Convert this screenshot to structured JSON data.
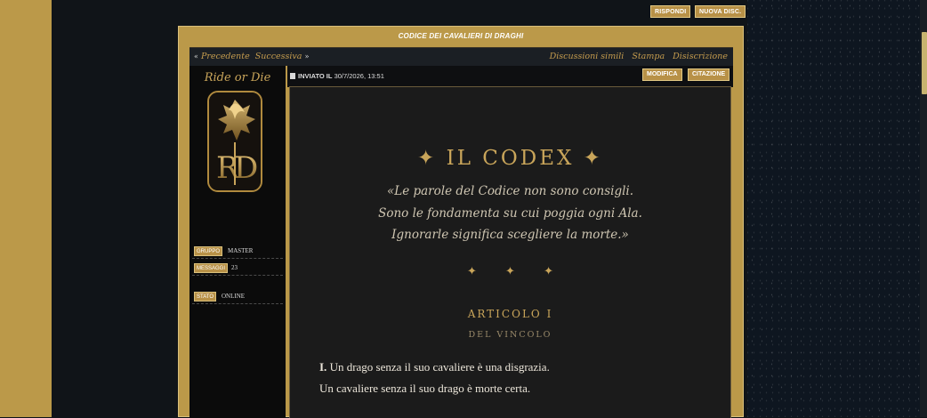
{
  "top_buttons": {
    "reply": "RISPONDI",
    "new_topic": "NUOVA DISC."
  },
  "topic": {
    "title": "CODICE DEI CAVALIERI DI DRAGHI"
  },
  "nav": {
    "prev_quote": "«",
    "prev": "Precedente",
    "next": "Successiva",
    "next_quote": "»",
    "similar": "Discussioni simili",
    "print": "Stampa",
    "unsubscribe": "Disiscrizione"
  },
  "profile": {
    "name": "Ride or Die",
    "group_label": "GRUPPO",
    "group_value": "MASTER",
    "messages_label": "MESSAGGI",
    "messages_value": "23",
    "status_label": "STATO",
    "status_value": "ONLINE"
  },
  "post": {
    "sent_label": "INVIATO IL",
    "date": "30/7/2026, 13:51",
    "edit_button": "MODIFICA",
    "quote_button": "CITAZIONE"
  },
  "content": {
    "title": "✦ IL CODEX ✦",
    "quote_lines": [
      "«Le parole del Codice non sono consigli.",
      "Sono le fondamenta su cui poggia ogni Ala.",
      "Ignorarle significa scegliere la morte.»"
    ],
    "stars": "✦ ✦ ✦",
    "article_title": "ARTICOLO I",
    "article_subtitle": "DEL VINCOLO",
    "article_num": "I.",
    "line1": "Un drago senza il suo cavaliere è una disgrazia.",
    "line2": "Un cavaliere senza il suo drago è morte certa."
  },
  "colors": {
    "gold": "#bb9949",
    "gold_text": "#c9a55a",
    "dark": "#0b0b0b",
    "panel": "#1b1b1b"
  }
}
